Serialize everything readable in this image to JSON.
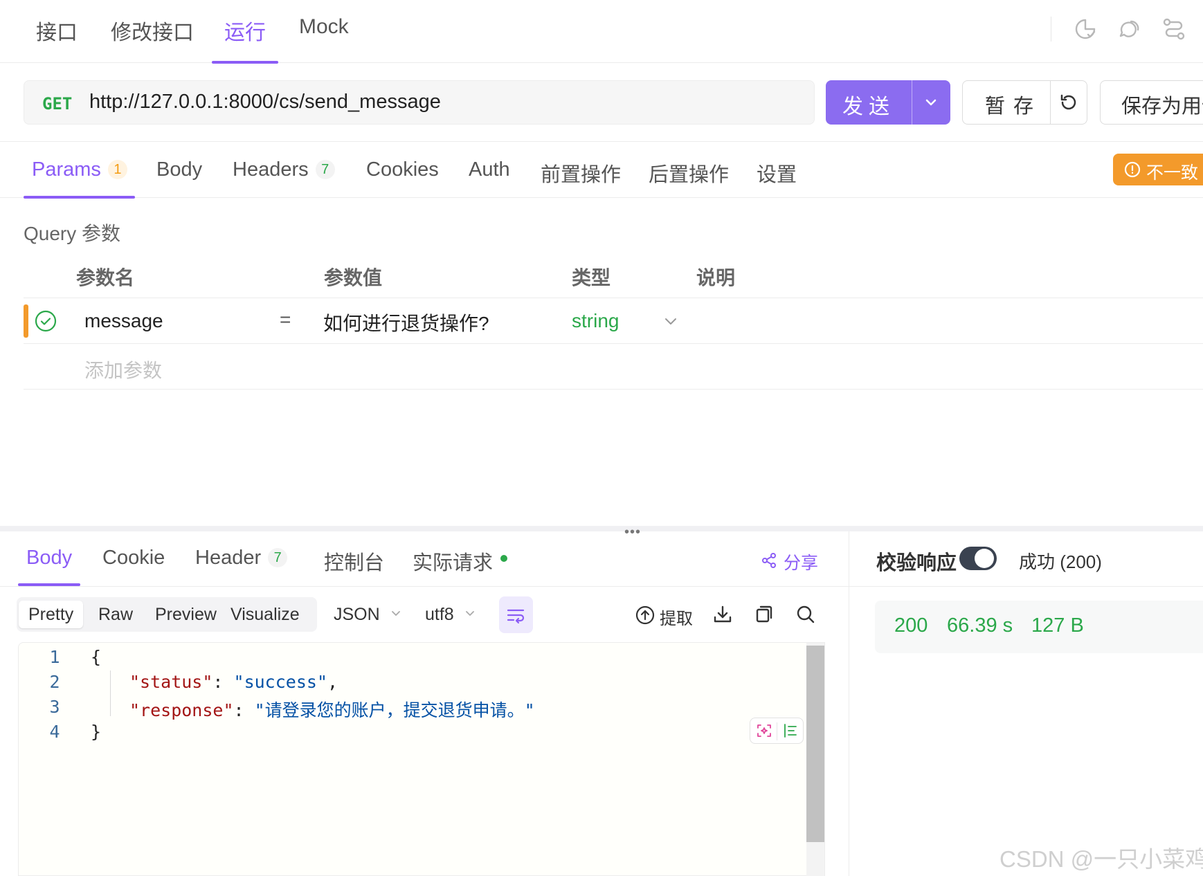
{
  "top_tabs": [
    "接口",
    "修改接口",
    "运行",
    "Mock"
  ],
  "top_tab_active": "运行",
  "request": {
    "method": "GET",
    "url": "http://127.0.0.1:8000/cs/send_message",
    "send_label": "发送",
    "stash_label": "暂 存",
    "save_case_label": "保存为用例"
  },
  "request_tabs": {
    "params": {
      "label": "Params",
      "count": "1"
    },
    "body": {
      "label": "Body"
    },
    "headers": {
      "label": "Headers",
      "count": "7"
    },
    "cookies": {
      "label": "Cookies"
    },
    "auth": {
      "label": "Auth"
    },
    "pre": {
      "label": "前置操作"
    },
    "post": {
      "label": "后置操作"
    },
    "settings": {
      "label": "设置"
    }
  },
  "mismatch_label": "不一致",
  "query": {
    "title": "Query 参数",
    "columns": [
      "参数名",
      "参数值",
      "类型",
      "说明"
    ],
    "rows": [
      {
        "name": "message",
        "equals": "=",
        "value": "如何进行退货操作?",
        "type": "string"
      }
    ],
    "add_placeholder": "添加参数"
  },
  "response_tabs": {
    "body": {
      "label": "Body"
    },
    "cookie": {
      "label": "Cookie"
    },
    "header": {
      "label": "Header",
      "count": "7"
    },
    "console": {
      "label": "控制台"
    },
    "actual": {
      "label": "实际请求"
    }
  },
  "share_label": "分享",
  "format_tabs": [
    "Pretty",
    "Raw",
    "Preview",
    "Visualize"
  ],
  "format_active": "Pretty",
  "language": "JSON",
  "encoding": "utf8",
  "extract_label": "提取",
  "code": {
    "line_numbers": [
      "1",
      "2",
      "3",
      "4"
    ],
    "open": "{",
    "status_key": "\"status\"",
    "status_value": "\"success\"",
    "response_key": "\"response\"",
    "response_value": "\"请登录您的账户，提交退货申请。\"",
    "close": "}"
  },
  "validate": {
    "label": "校验响应",
    "enabled": true,
    "result": "成功 (200)"
  },
  "stats": {
    "status": "200",
    "time": "66.39 s",
    "size": "127 B"
  },
  "watermark": "CSDN @一只小菜鸡",
  "colors": {
    "accent": "#8b5cf6",
    "send_button": "#8b6cf0",
    "success": "#2ba84a",
    "warning": "#f39a2b"
  }
}
